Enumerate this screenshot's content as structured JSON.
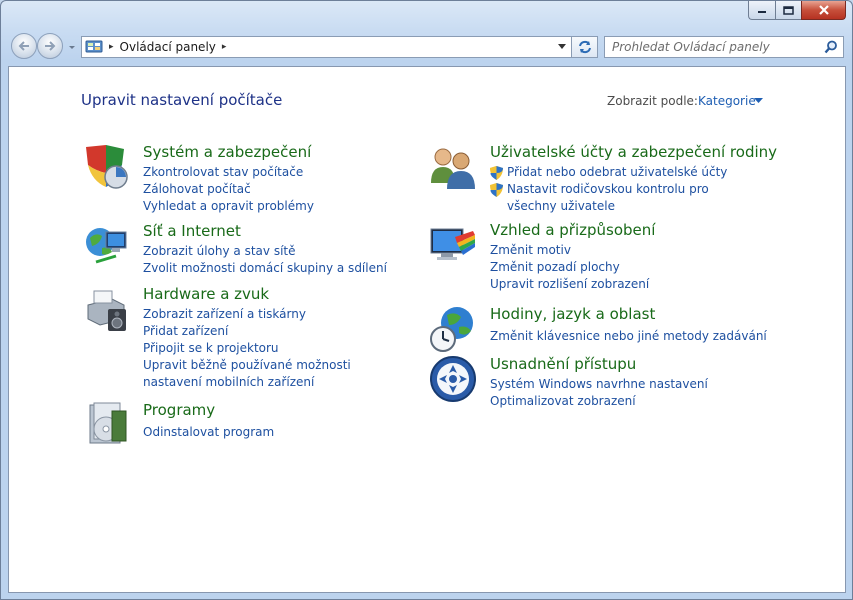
{
  "window": {
    "title": "",
    "controls": {
      "minimize": "minimize",
      "maximize": "maximize",
      "close": "close"
    }
  },
  "toolbar": {
    "address": {
      "root_arrow": "▸",
      "crumb": "Ovládací panely",
      "crumb_arrow": "▸"
    },
    "search": {
      "placeholder": "Prohledat Ovládací panely"
    }
  },
  "main": {
    "title": "Upravit nastavení počítače",
    "view_by_label": "Zobrazit podle:",
    "view_by_value": "Kategorie"
  },
  "categories": [
    {
      "title": "Systém a zabezpečení",
      "icon": "system-security-icon",
      "links": [
        "Zkontrolovat stav počítače",
        "Zálohovat počítač",
        "Vyhledat a opravit problémy"
      ]
    },
    {
      "title": "Síť a Internet",
      "icon": "network-internet-icon",
      "links": [
        "Zobrazit úlohy a stav sítě",
        "Zvolit možnosti domácí skupiny a sdílení"
      ]
    },
    {
      "title": "Hardware a zvuk",
      "icon": "hardware-sound-icon",
      "links": [
        "Zobrazit zařízení a tiskárny",
        "Přidat zařízení",
        "Připojit se k projektoru",
        "Upravit běžně používané možnosti nastavení mobilních zařízení"
      ]
    },
    {
      "title": "Programy",
      "icon": "programs-icon",
      "links": [
        "Odinstalovat program"
      ]
    },
    {
      "title": "Uživatelské účty a zabezpečení rodiny",
      "icon": "user-accounts-icon",
      "links": [
        "Přidat nebo odebrat uživatelské účty",
        "Nastavit rodičovskou kontrolu pro všechny uživatele"
      ]
    },
    {
      "title": "Vzhled a přizpůsobení",
      "icon": "appearance-icon",
      "links": [
        "Změnit motiv",
        "Změnit pozadí plochy",
        "Upravit rozlišení zobrazení"
      ]
    },
    {
      "title": "Hodiny, jazyk a oblast",
      "icon": "clock-language-icon",
      "links": [
        "Změnit klávesnice nebo jiné metody zadávání"
      ]
    },
    {
      "title": "Usnadnění přístupu",
      "icon": "ease-of-access-icon",
      "links": [
        "Systém Windows navrhne nastavení",
        "Optimalizovat zobrazení"
      ]
    }
  ],
  "colors": {
    "link": "#1e50a0",
    "category_title": "#196a19",
    "page_title": "#1e3287"
  }
}
